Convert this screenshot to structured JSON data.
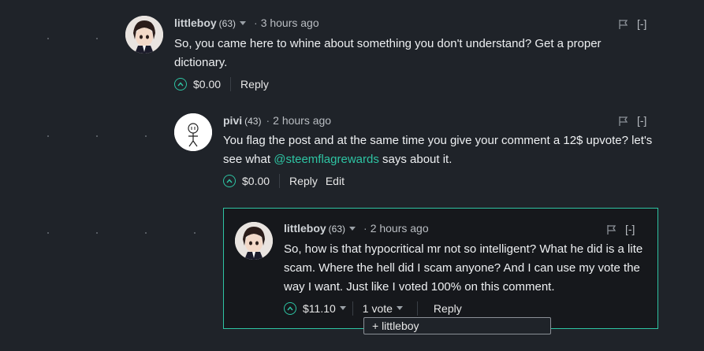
{
  "comments": [
    {
      "author": "littleboy",
      "reputation": "(63)",
      "time": "3 hours ago",
      "collapse": "[-]",
      "body": "So, you came here to whine about something you don't understand? Get a proper dictionary.",
      "payout": "$0.00",
      "reply": "Reply"
    },
    {
      "author": "pivi",
      "reputation": "(43)",
      "time": "2 hours ago",
      "collapse": "[-]",
      "body_before": "You flag the post and at the same time you give your comment a 12$ upvote? let's see what ",
      "mention": "@steemflagrewards",
      "body_after": " says about it.",
      "payout": "$0.00",
      "reply": "Reply",
      "edit": "Edit"
    },
    {
      "author": "littleboy",
      "reputation": "(63)",
      "time": "2 hours ago",
      "collapse": "[-]",
      "body": "So, how is that hypocritical mr not so intelligent? What he did is a lite scam. Where the hell did I scam anyone? And I can use my vote the way I want. Just like I voted 100% on this comment.",
      "payout": "$11.10",
      "votes": "1 vote",
      "reply": "Reply"
    }
  ],
  "vote_dropdown": {
    "item": "+ littleboy"
  },
  "colors": {
    "accent": "#2ec4a3",
    "background": "#1f2329",
    "nested_bg": "#16181c"
  },
  "icons": [
    "flag-icon",
    "upvote-chevron-icon",
    "caret-down-icon"
  ]
}
